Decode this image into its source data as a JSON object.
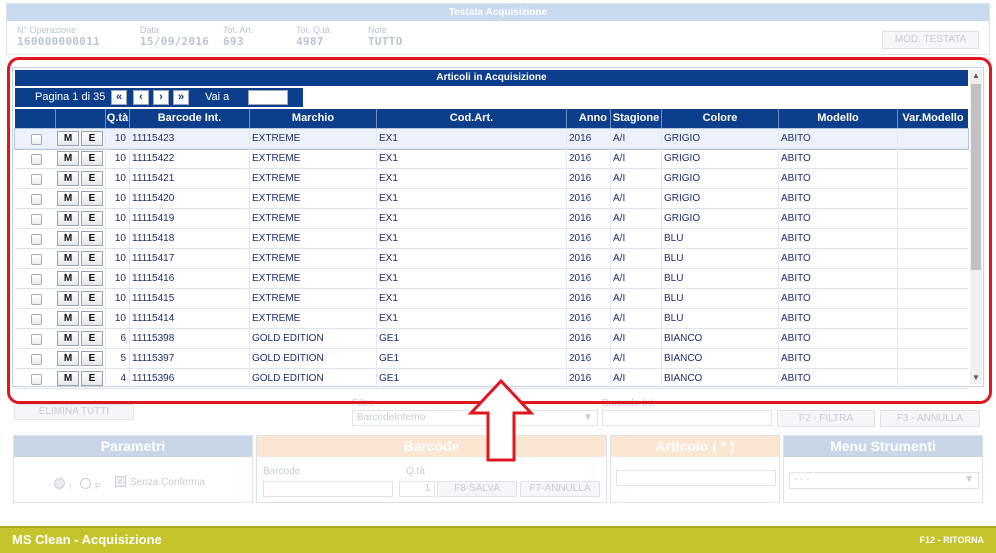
{
  "header": {
    "title": "Testata Acquisizione",
    "fields": [
      {
        "label": "N° Operazione",
        "value": "160000000011"
      },
      {
        "label": "Data",
        "value": "15/09/2016"
      },
      {
        "label": "Tot. Art.",
        "value": "693"
      },
      {
        "label": "Tot. Q.tà",
        "value": "4987"
      },
      {
        "label": "Note",
        "value": "TUTTO"
      }
    ],
    "mod_button": "MOD. TESTATA"
  },
  "grid": {
    "title": "Articoli in Acquisizione",
    "pager": {
      "info": "Pagina 1 di 35",
      "first": "«",
      "prev": "‹",
      "next": "›",
      "last": "»",
      "goto_label": "Vai a",
      "goto_value": ""
    },
    "columns": [
      "Q.tà",
      "Barcode Int.",
      "Marchio",
      "Cod.Art.",
      "Anno",
      "Stagione",
      "Colore",
      "Modello",
      "Var.Modello"
    ],
    "row_buttons": {
      "m": "M",
      "e": "E"
    },
    "rows": [
      {
        "qta": "10",
        "barcode": "11115423",
        "marchio": "EXTREME",
        "codart": "EX1",
        "anno": "2016",
        "stagione": "A/I",
        "colore": "GRIGIO",
        "modello": "ABITO",
        "var": ""
      },
      {
        "qta": "10",
        "barcode": "11115422",
        "marchio": "EXTREME",
        "codart": "EX1",
        "anno": "2016",
        "stagione": "A/I",
        "colore": "GRIGIO",
        "modello": "ABITO",
        "var": ""
      },
      {
        "qta": "10",
        "barcode": "11115421",
        "marchio": "EXTREME",
        "codart": "EX1",
        "anno": "2016",
        "stagione": "A/I",
        "colore": "GRIGIO",
        "modello": "ABITO",
        "var": ""
      },
      {
        "qta": "10",
        "barcode": "11115420",
        "marchio": "EXTREME",
        "codart": "EX1",
        "anno": "2016",
        "stagione": "A/I",
        "colore": "GRIGIO",
        "modello": "ABITO",
        "var": ""
      },
      {
        "qta": "10",
        "barcode": "11115419",
        "marchio": "EXTREME",
        "codart": "EX1",
        "anno": "2016",
        "stagione": "A/I",
        "colore": "GRIGIO",
        "modello": "ABITO",
        "var": ""
      },
      {
        "qta": "10",
        "barcode": "11115418",
        "marchio": "EXTREME",
        "codart": "EX1",
        "anno": "2016",
        "stagione": "A/I",
        "colore": "BLU",
        "modello": "ABITO",
        "var": ""
      },
      {
        "qta": "10",
        "barcode": "11115417",
        "marchio": "EXTREME",
        "codart": "EX1",
        "anno": "2016",
        "stagione": "A/I",
        "colore": "BLU",
        "modello": "ABITO",
        "var": ""
      },
      {
        "qta": "10",
        "barcode": "11115416",
        "marchio": "EXTREME",
        "codart": "EX1",
        "anno": "2016",
        "stagione": "A/I",
        "colore": "BLU",
        "modello": "ABITO",
        "var": ""
      },
      {
        "qta": "10",
        "barcode": "11115415",
        "marchio": "EXTREME",
        "codart": "EX1",
        "anno": "2016",
        "stagione": "A/I",
        "colore": "BLU",
        "modello": "ABITO",
        "var": ""
      },
      {
        "qta": "10",
        "barcode": "11115414",
        "marchio": "EXTREME",
        "codart": "EX1",
        "anno": "2016",
        "stagione": "A/I",
        "colore": "BLU",
        "modello": "ABITO",
        "var": ""
      },
      {
        "qta": "6",
        "barcode": "11115398",
        "marchio": "GOLD EDITION",
        "codart": "GE1",
        "anno": "2016",
        "stagione": "A/I",
        "colore": "BIANCO",
        "modello": "ABITO",
        "var": ""
      },
      {
        "qta": "5",
        "barcode": "11115397",
        "marchio": "GOLD EDITION",
        "codart": "GE1",
        "anno": "2016",
        "stagione": "A/I",
        "colore": "BIANCO",
        "modello": "ABITO",
        "var": ""
      },
      {
        "qta": "4",
        "barcode": "11115396",
        "marchio": "GOLD EDITION",
        "codart": "GE1",
        "anno": "2016",
        "stagione": "A/I",
        "colore": "BIANCO",
        "modello": "ABITO",
        "var": ""
      }
    ]
  },
  "toolbar": {
    "elimina": "ELIMINA TUTTI",
    "filtro_label": "Filtro",
    "filtro_value": "BarcodeInterno",
    "barcode_label": "Barcode Int.",
    "filtra": "F2 - FILTRA",
    "annulla": "F3 - ANNULLA"
  },
  "sections": {
    "parametri": {
      "title": "Parametri",
      "radio_i": "I",
      "radio_p": "P",
      "checkbox": "Senza Conferma"
    },
    "barcode": {
      "title": "Barcode",
      "barcode_label": "Barcode",
      "qta_label": "Q.tà",
      "qta_value": "1",
      "salva": "F8-SALVA",
      "annulla": "F7-ANNULLA"
    },
    "articolo": {
      "title": "Articolo ( * )"
    },
    "menu": {
      "title": "Menu Strumenti",
      "select_value": "- - -"
    }
  },
  "footer": {
    "title": "MS Clean - Acquisizione",
    "right": "F12 - RITORNA"
  },
  "colors": {
    "accent": "#0d3e8c",
    "highlight": "#e0161d",
    "footer": "#c5c42a"
  }
}
